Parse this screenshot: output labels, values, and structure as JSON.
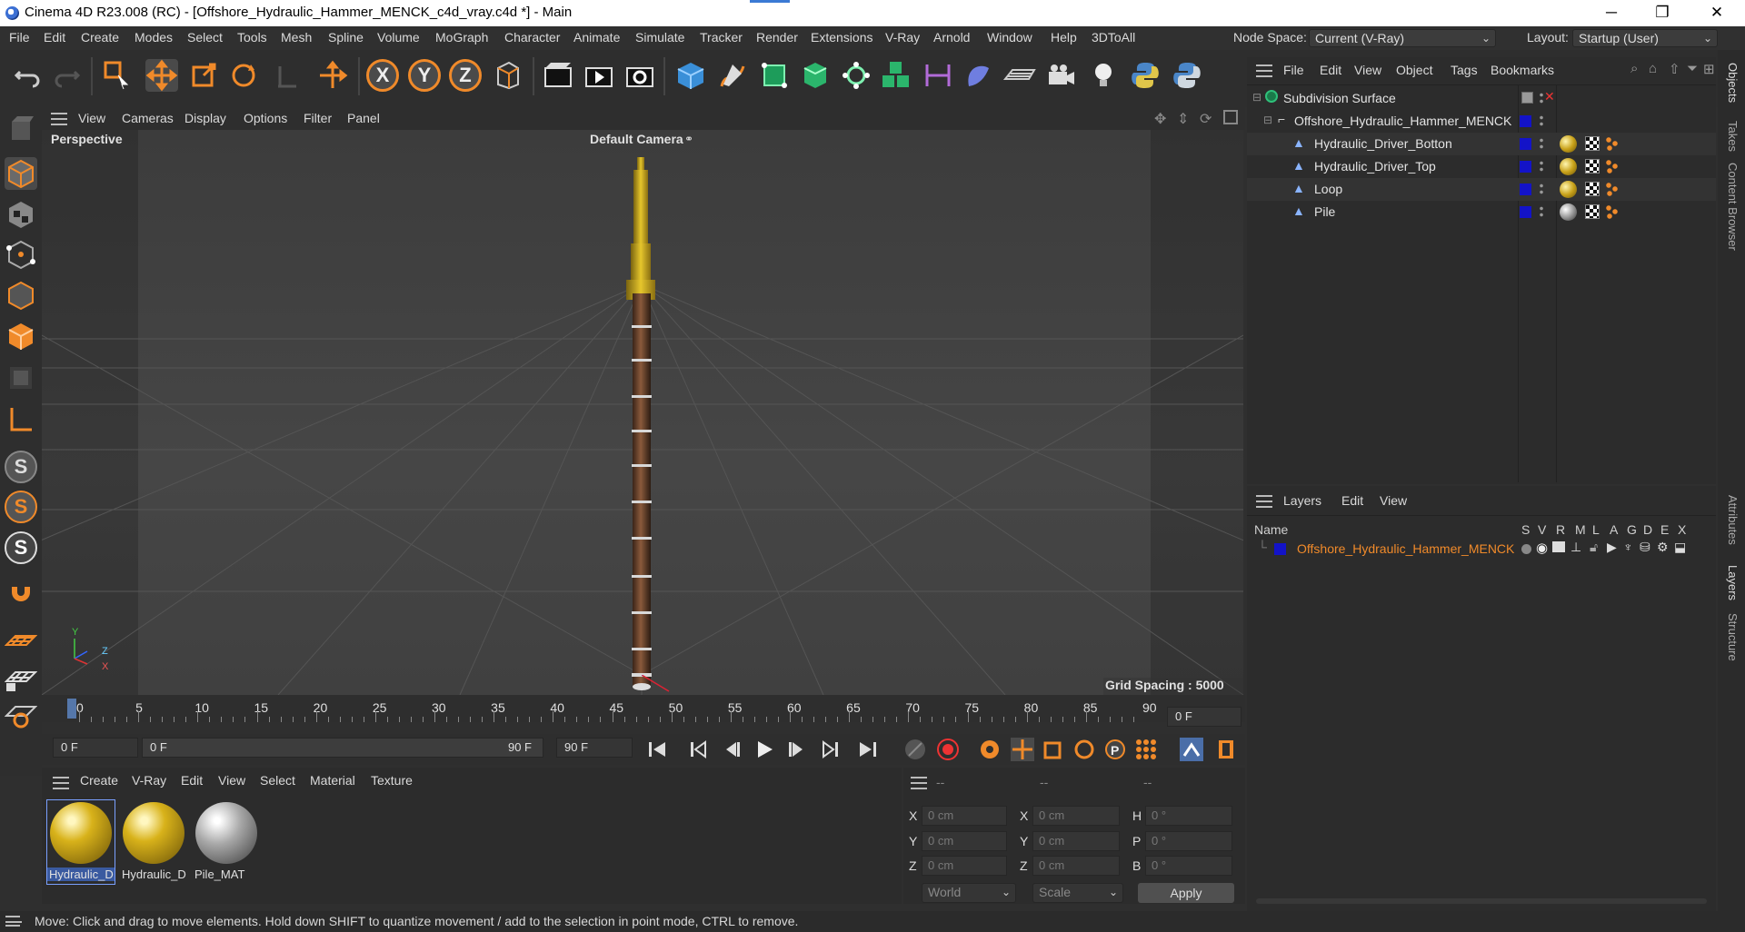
{
  "window": {
    "title": "Cinema 4D R23.008 (RC) - [Offshore_Hydraulic_Hammer_MENCK_c4d_vray.c4d *] - Main",
    "minimize": "─",
    "restore": "❐",
    "close": "✕"
  },
  "menubar": {
    "items": [
      "File",
      "Edit",
      "Create",
      "Modes",
      "Select",
      "Tools",
      "Mesh",
      "Spline",
      "Volume",
      "MoGraph",
      "Character",
      "Animate",
      "Simulate",
      "Tracker",
      "Render",
      "Extensions",
      "V-Ray",
      "Arnold",
      "Window",
      "Help",
      "3DToAll"
    ],
    "node_space_label": "Node Space:",
    "node_space_value": "Current (V-Ray)",
    "layout_label": "Layout:",
    "layout_value": "Startup (User)"
  },
  "toolbar": {
    "axis_x": "X",
    "axis_y": "Y",
    "axis_z": "Z",
    "icons": [
      "undo-icon",
      "redo-icon",
      "live-select-icon",
      "move-icon",
      "scale-icon",
      "rotate-icon",
      "recent-tool-icon",
      "add-icon",
      "axis-x-icon",
      "axis-y-icon",
      "axis-z-icon",
      "coordinate-system-icon",
      "render-view-icon",
      "render-picture-viewer-icon",
      "render-settings-icon",
      "cube-icon",
      "pen-icon",
      "subdivision-icon",
      "extrude-icon",
      "cloner-icon",
      "array-icon",
      "symmetry-icon",
      "deformer-icon",
      "floor-icon",
      "camera-icon",
      "light-icon",
      "python-icon",
      "python-script-icon"
    ]
  },
  "viewport": {
    "menu": [
      "View",
      "Cameras",
      "Display",
      "Options",
      "Filter",
      "Panel"
    ],
    "name": "Perspective",
    "camera": "Default Camera",
    "grid_spacing": "Grid Spacing : 5000 cm",
    "axis_y": "Y",
    "axis_z": "Z",
    "axis_x": "X"
  },
  "timeline": {
    "ticks": [
      "0",
      "5",
      "10",
      "15",
      "20",
      "25",
      "30",
      "35",
      "40",
      "45",
      "50",
      "55",
      "60",
      "65",
      "70",
      "75",
      "80",
      "85",
      "90"
    ],
    "current_frame": "0 F"
  },
  "transport": {
    "start": "0 F",
    "range_start": "0 F",
    "range_end": "90 F",
    "end": "90 F"
  },
  "materials": {
    "menu": [
      "Create",
      "V-Ray",
      "Edit",
      "View",
      "Select",
      "Material",
      "Texture"
    ],
    "items": [
      {
        "name": "Hydraulic_D",
        "selected": true
      },
      {
        "name": "Hydraulic_D",
        "selected": false
      },
      {
        "name": "Pile_MAT",
        "selected": false
      }
    ]
  },
  "coords": {
    "headers": [
      "--",
      "--",
      "--"
    ],
    "rows": [
      {
        "a": "X",
        "av": "0 cm",
        "b": "X",
        "bv": "0 cm",
        "c": "H",
        "cv": "0 °"
      },
      {
        "a": "Y",
        "av": "0 cm",
        "b": "Y",
        "bv": "0 cm",
        "c": "P",
        "cv": "0 °"
      },
      {
        "a": "Z",
        "av": "0 cm",
        "b": "Z",
        "bv": "0 cm",
        "c": "B",
        "cv": "0 °"
      }
    ],
    "mode1": "World",
    "mode2": "Scale",
    "apply": "Apply"
  },
  "objects": {
    "menu": [
      "File",
      "Edit",
      "View",
      "Object",
      "Tags",
      "Bookmarks"
    ],
    "rows": [
      {
        "name": "Subdivision Surface",
        "indent": 0
      },
      {
        "name": "Offshore_Hydraulic_Hammer_MENCK",
        "indent": 1
      },
      {
        "name": "Hydraulic_Driver_Botton",
        "indent": 2
      },
      {
        "name": "Hydraulic_Driver_Top",
        "indent": 2
      },
      {
        "name": "Loop",
        "indent": 2
      },
      {
        "name": "Pile",
        "indent": 2
      }
    ]
  },
  "layers": {
    "menu": [
      "Layers",
      "Edit",
      "View"
    ],
    "columns": {
      "name": "Name",
      "flags": [
        "S",
        "V",
        "R",
        "M",
        "L",
        "A",
        "G",
        "D",
        "E",
        "X"
      ]
    },
    "rows": [
      {
        "name": "Offshore_Hydraulic_Hammer_MENCK",
        "color": "#1313c8"
      }
    ]
  },
  "sidetabs": [
    "Objects",
    "Takes",
    "Content Browser",
    "Attributes",
    "Layers",
    "Structure"
  ],
  "status": "Move: Click and drag to move elements. Hold down SHIFT to quantize movement / add to the selection in point mode, CTRL to remove.",
  "colors": {
    "accent": "#f08a2a",
    "hammer": "#d8b21a",
    "layer_name": "#f08a2a"
  }
}
